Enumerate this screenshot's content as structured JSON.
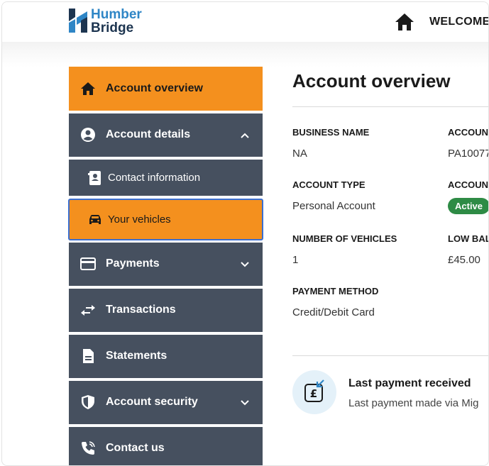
{
  "brand": {
    "line1": "Humber",
    "line2": "Bridge"
  },
  "header": {
    "welcome": "WELCOME"
  },
  "sidebar": {
    "items": [
      {
        "label": "Account overview",
        "icon": "home-icon"
      },
      {
        "label": "Account details",
        "icon": "account-circle-icon"
      },
      {
        "label": "Contact information",
        "icon": "contact-card-icon"
      },
      {
        "label": "Your vehicles",
        "icon": "car-icon"
      },
      {
        "label": "Payments",
        "icon": "card-icon"
      },
      {
        "label": "Transactions",
        "icon": "swap-arrows-icon"
      },
      {
        "label": "Statements",
        "icon": "document-icon"
      },
      {
        "label": "Account security",
        "icon": "shield-icon"
      },
      {
        "label": "Contact us",
        "icon": "phone-icon"
      }
    ]
  },
  "main": {
    "title": "Account overview",
    "business_name_label": "BUSINESS NAME",
    "business_name_value": "NA",
    "account_col_label": "ACCOUN",
    "account_col_value": "PA10077",
    "account_type_label": "ACCOUNT TYPE",
    "account_type_value": "Personal Account",
    "account_status_label": "ACCOUN",
    "account_status_badge": "Active",
    "vehicles_label": "NUMBER OF VEHICLES",
    "vehicles_value": "1",
    "low_balance_label": "LOW BAL",
    "low_balance_value": "£45.00",
    "payment_method_label": "PAYMENT METHOD",
    "payment_method_value": "Credit/Debit Card",
    "last_payment_title": "Last payment received",
    "last_payment_sub": "Last payment made via Mig"
  },
  "colors": {
    "active": "#f4901e",
    "nav": "#46505f",
    "badge": "#2e8b45",
    "brand_blue": "#2f86c6",
    "brand_navy": "#1d3550"
  }
}
